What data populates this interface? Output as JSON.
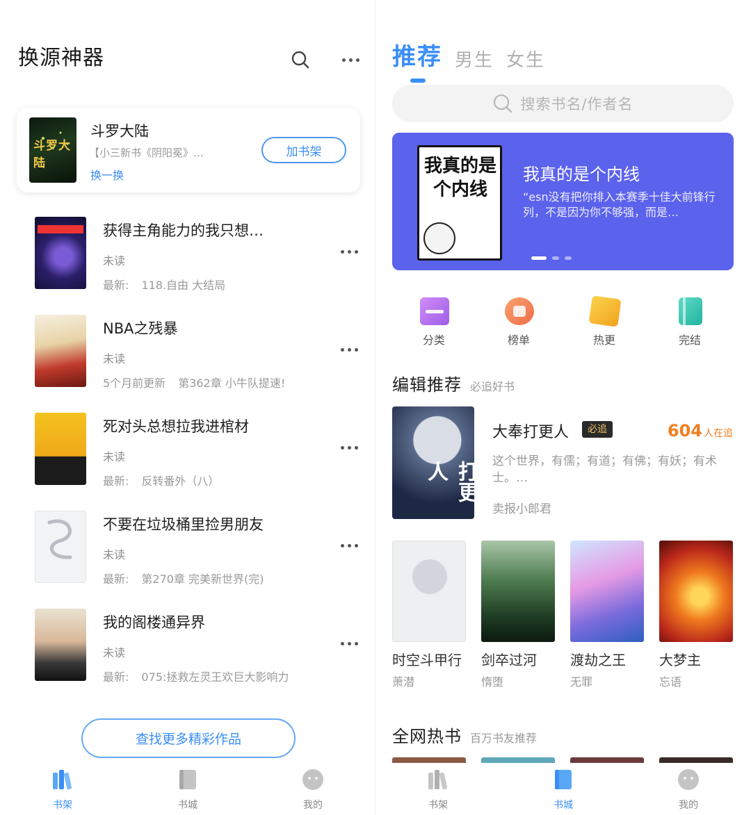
{
  "left": {
    "title": "换源神器",
    "suggestion": {
      "cover_text": "斗罗大陆",
      "title": "斗罗大陆",
      "desc": "【小三新书《阴阳冕》…",
      "switch_label": "换一换",
      "add_label": "加书架"
    },
    "books": [
      {
        "title": "获得主角能力的我只想…",
        "status": "未读",
        "latest_label": "最新:",
        "latest": "118.自由 大结局"
      },
      {
        "title": "NBA之残暴",
        "status": "未读",
        "latest_label": "5个月前更新",
        "latest": "第362章 小牛队提速!"
      },
      {
        "title": "死对头总想拉我进棺材",
        "status": "未读",
        "latest_label": "最新:",
        "latest": "反转番外（八）"
      },
      {
        "title": "不要在垃圾桶里捡男朋友",
        "status": "未读",
        "latest_label": "最新:",
        "latest": "第270章 完美新世界(完)"
      },
      {
        "title": "我的阁楼通异界",
        "status": "未读",
        "latest_label": "最新:",
        "latest": "075:拯救左灵王欢巨大影响力"
      }
    ],
    "find_more": "查找更多精彩作品",
    "tabbar": [
      {
        "label": "书架",
        "icon": "bookshelf-icon",
        "active": true
      },
      {
        "label": "书城",
        "icon": "bookstore-icon",
        "active": false
      },
      {
        "label": "我的",
        "icon": "profile-icon",
        "active": false
      }
    ]
  },
  "right": {
    "tabs": [
      "推荐",
      "男生",
      "女生"
    ],
    "search_placeholder": "搜索书名/作者名",
    "banner": {
      "cover_text": "我真的是个内线",
      "title": "我真的是个内线",
      "desc": "“esn没有把你排入本赛季十佳大前锋行列，不是因为你不够强，而是…"
    },
    "quick": [
      {
        "label": "分类",
        "icon": "category-icon",
        "color": "#b76cf0"
      },
      {
        "label": "榜单",
        "icon": "ranking-icon",
        "color": "#f08a5e"
      },
      {
        "label": "热更",
        "icon": "hot-update-icon",
        "color": "#f6b731"
      },
      {
        "label": "完结",
        "icon": "completed-icon",
        "color": "#3cc6b4"
      }
    ],
    "editor_section": {
      "title": "编辑推荐",
      "subtitle": "必追好书"
    },
    "featured": {
      "cover_text": "打更人",
      "title": "大奉打更人",
      "badge": "必追",
      "count": "604",
      "count_suffix": "人在追",
      "desc": "这个世界，有儒；有道；有佛；有妖；有术士。…",
      "author": "卖报小郎君"
    },
    "grid": [
      {
        "title": "时空斗甲行",
        "author": "萧潜"
      },
      {
        "title": "剑卒过河",
        "author": "惰堕"
      },
      {
        "title": "渡劫之王",
        "author": "无罪"
      },
      {
        "title": "大梦主",
        "author": "忘语"
      }
    ],
    "hot_section": {
      "title": "全网热书",
      "subtitle": "百万书友推荐"
    },
    "tabbar": [
      {
        "label": "书架",
        "icon": "bookshelf-icon",
        "active": false
      },
      {
        "label": "书城",
        "icon": "bookstore-icon",
        "active": true
      },
      {
        "label": "我的",
        "icon": "profile-icon",
        "active": false
      }
    ],
    "colors": {
      "accent": "#3a8ef6",
      "banner": "#5b62ec",
      "count": "#f07f22"
    }
  }
}
